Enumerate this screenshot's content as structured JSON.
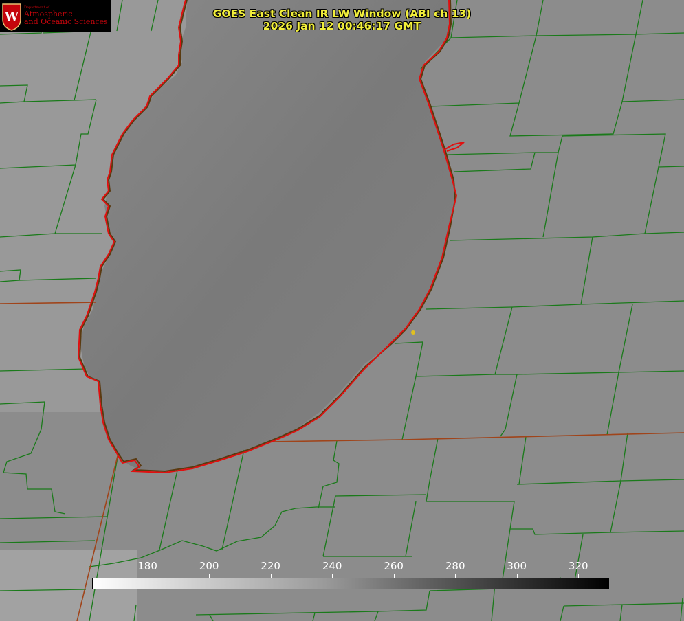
{
  "title": {
    "line1": "GOES East Clean IR LW Window (ABI ch 13)",
    "line2": "2026 Jan 12 00:46:17 GMT"
  },
  "logo": {
    "department": "Department of",
    "line1": "Atmospheric",
    "line2": "and Oceanic Sciences",
    "crest_letter": "W"
  },
  "colorbar": {
    "min": 162,
    "max": 330,
    "ticks": [
      "180",
      "200",
      "220",
      "240",
      "260",
      "280",
      "300",
      "320"
    ],
    "direction": "white-to-black"
  },
  "colors": {
    "title_text": "#f2ef3a",
    "boundary_lines": "#1a7a1a",
    "lake_outline": "#e01010",
    "state_border": "#a0441a",
    "marker": "#e0c020"
  }
}
